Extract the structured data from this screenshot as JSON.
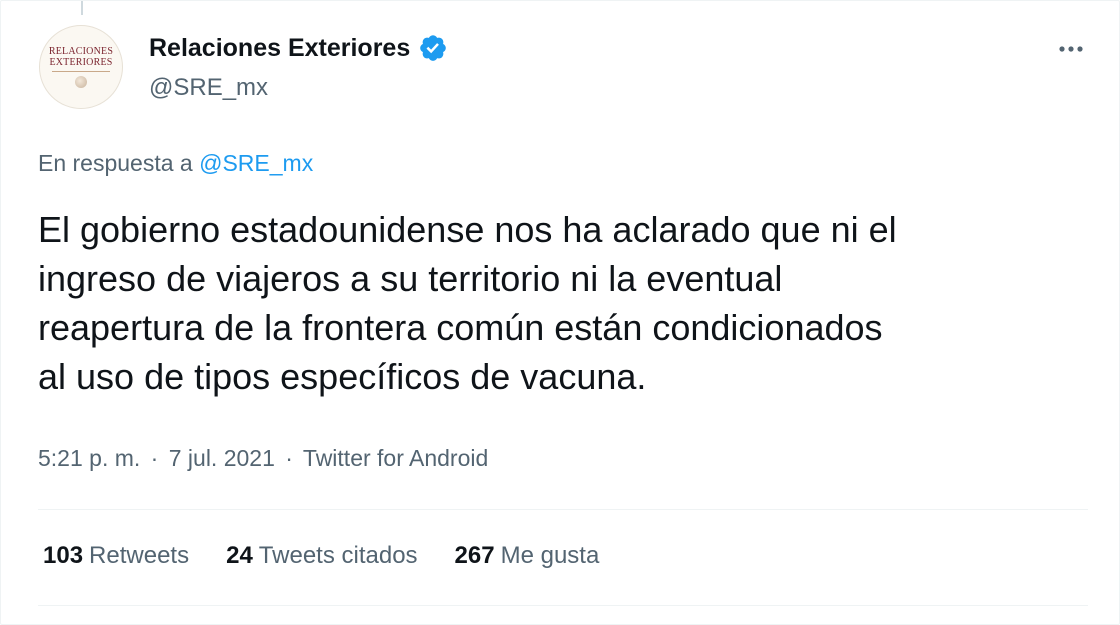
{
  "tweet": {
    "author": {
      "name": "Relaciones Exteriores",
      "handle": "@SRE_mx",
      "avatar_logo_lines": [
        "RELACIONES",
        "EXTERIORES"
      ],
      "verified": true
    },
    "reply_to": {
      "prefix": "En respuesta a",
      "handle": "@SRE_mx"
    },
    "text_lines": [
      "El gobierno estadounidense nos ha aclarado que ni el",
      "ingreso de viajeros a su territorio ni la eventual",
      "reapertura de la frontera común están condicionados",
      "al uso de tipos específicos de vacuna."
    ],
    "meta": {
      "time": "5:21 p. m.",
      "date": "7 jul. 2021",
      "source": "Twitter for Android",
      "separator": "·"
    },
    "stats": [
      {
        "count": "103",
        "label": "Retweets"
      },
      {
        "count": "24",
        "label": "Tweets citados"
      },
      {
        "count": "267",
        "label": "Me gusta"
      }
    ]
  },
  "icons": {
    "verified": "verified-badge-icon",
    "more": "more-options-icon"
  },
  "colors": {
    "text_primary": "#0f1419",
    "text_secondary": "#536471",
    "accent": "#1d9bf0",
    "divider": "#eff3f4",
    "logo": "#7c2630"
  }
}
